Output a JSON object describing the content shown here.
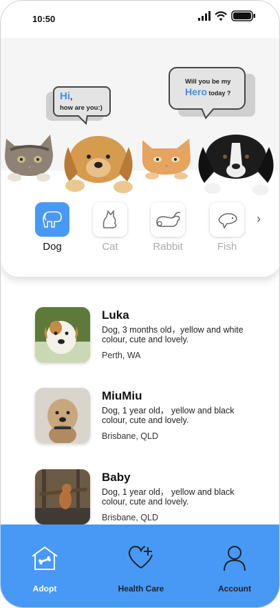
{
  "status_bar": {
    "time": "10:50"
  },
  "bubbles": {
    "left": {
      "greeting": "Hi",
      "comma": ",",
      "line2": "how are you:)"
    },
    "right": {
      "line1": "Will you be my",
      "hero": "Hero",
      "line2_rest": "today ?"
    }
  },
  "categories": [
    {
      "label": "Dog",
      "icon": "dog-icon",
      "active": true
    },
    {
      "label": "Cat",
      "icon": "cat-icon",
      "active": false
    },
    {
      "label": "Rabbit",
      "icon": "rabbit-icon",
      "active": false
    },
    {
      "label": "Fish",
      "icon": "fish-icon",
      "active": false
    }
  ],
  "pets": [
    {
      "name": "Luka",
      "description": "Dog, 3 months old，yellow and white colour, cute and lovely.",
      "location": "Perth, WA"
    },
    {
      "name": "MiuMiu",
      "description": "Dog, 1 year old， yellow and black colour, cute and lovely.",
      "location": "Brisbane, QLD"
    },
    {
      "name": "Baby",
      "description": "Dog, 1 year old， yellow and black colour, cute and lovely.",
      "location": "Brisbane, QLD"
    }
  ],
  "bottom_nav": [
    {
      "label": "Adopt",
      "icon": "home-bone-icon",
      "active": true
    },
    {
      "label": "Health Care",
      "icon": "heart-plus-icon",
      "active": false
    },
    {
      "label": "Account",
      "icon": "person-icon",
      "active": false
    }
  ],
  "colors": {
    "accent": "#4799f5",
    "hero_text": "#3f8ff0"
  }
}
